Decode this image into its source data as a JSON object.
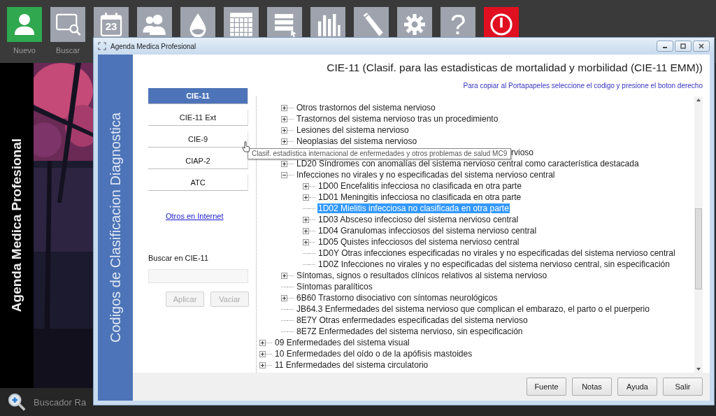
{
  "desktop": {
    "toolbar": [
      {
        "kind": "user",
        "color": "#2fa84f",
        "label": "Nuevo"
      },
      {
        "kind": "search",
        "color": "#9ea3ad",
        "label": "Buscar"
      },
      {
        "kind": "calendar",
        "color": "#9ea3ad",
        "text": "23"
      },
      {
        "kind": "people",
        "color": "#9ea3ad"
      },
      {
        "kind": "drop",
        "color": "#9ea3ad"
      },
      {
        "kind": "grid",
        "color": "#9ea3ad"
      },
      {
        "kind": "list",
        "color": "#9ea3ad"
      },
      {
        "kind": "chart",
        "color": "#9ea3ad"
      },
      {
        "kind": "pen",
        "color": "#9ea3ad"
      },
      {
        "kind": "gear",
        "color": "#9ea3ad"
      },
      {
        "kind": "help",
        "color": "#9ea3ad",
        "text": "?"
      },
      {
        "kind": "power",
        "color": "#e01020"
      }
    ],
    "side_title": "Agenda Medica Profesional",
    "quick_search": "Buscador Ra"
  },
  "window": {
    "title": "Agenda Medica Profesional",
    "side_title": "Codigos de Clasificacion Diagnostica",
    "heading": "CIE-11 (Clasif. para las estadisticas de mortalidad y morbilidad (CIE-11 EMM))",
    "hint": "Para copiar al Portapapeles seleccione el codigo y presione el boton derecho",
    "classifications": [
      {
        "label": "CIE-11",
        "selected": true
      },
      {
        "label": "CIE-11 Ext",
        "selected": false
      },
      {
        "label": "CIE-9",
        "selected": false
      },
      {
        "label": "CIAP-2",
        "selected": false
      },
      {
        "label": "ATC",
        "selected": false
      }
    ],
    "link": "Otros en Internet",
    "search": {
      "label": "Buscar en CIE-11",
      "buttons": [
        {
          "label": "Aplicar",
          "disabled": true
        },
        {
          "label": "Vaciar",
          "disabled": true
        }
      ]
    },
    "tooltip": "Clasif. estadística internacional de enfermedades y otros problemas de salud MC9",
    "tree": {
      "continued_branch": [
        {
          "text": "Otros trastornos del sistema nervioso",
          "expanded": false,
          "selected": false
        },
        {
          "text": "Trastornos del sistema nervioso tras un procedimiento",
          "expanded": false,
          "selected": false
        },
        {
          "text": "Lesiones del sistema nervioso",
          "expanded": false,
          "selected": false
        },
        {
          "text": "Neoplasias del sistema nervioso",
          "expanded": false,
          "selected": false
        },
        {
          "text": "rvioso",
          "partly_covered": true,
          "selected": false
        },
        {
          "text": "LD20 Síndromes con anomalías del sistema nervioso central como característica destacada",
          "expanded": false,
          "selected": false
        },
        {
          "text": "Infecciones no virales y no especificadas del sistema nervioso central",
          "expanded": true,
          "selected": false,
          "children": [
            {
              "text": "1D00 Encefalitis infecciosa no clasificada en otra parte",
              "expanded": false,
              "selected": false
            },
            {
              "text": "1D01 Meningitis infecciosa no clasificada en otra parte",
              "expanded": false,
              "selected": false
            },
            {
              "text": "1D02 Mielitis infecciosa no clasificada en otra parte",
              "selected": true
            },
            {
              "text": "1D03 Absceso infeccioso del sistema nervioso central",
              "expanded": false,
              "selected": false
            },
            {
              "text": "1D04 Granulomas infecciosos del sistema nervioso central",
              "expanded": false,
              "selected": false
            },
            {
              "text": "1D05 Quistes infecciosos del sistema nervioso central",
              "expanded": false,
              "selected": false
            },
            {
              "text": "1D0Y Otras infecciones especificadas no virales y no especificadas del sistema nervioso central",
              "selected": false
            },
            {
              "text": "1D0Z Infecciones no virales y no especificadas del sistema nervioso central, sin especificación",
              "selected": false
            }
          ]
        },
        {
          "text": "Síntomas, signos o resultados clínicos relativos al sistema nervioso",
          "expanded": false,
          "selected": false
        },
        {
          "text": "Síntomas paralíticos",
          "selected": false
        },
        {
          "text": "6B60 Trastorno disociativo con síntomas neurológicos",
          "expanded": false,
          "selected": false
        },
        {
          "text": "JB64.3 Enfermedades del sistema nervioso que complican el embarazo, el parto o el puerperio",
          "selected": false
        },
        {
          "text": "8E7Y Otras enfermedades especificadas del sistema nervioso",
          "selected": false
        },
        {
          "text": "8E7Z Enfermedades del sistema nervioso, sin especificación",
          "selected": false
        }
      ],
      "items": [
        {
          "text": "09 Enfermedades del sistema visual",
          "expanded": false,
          "selected": false
        },
        {
          "text": "10 Enfermedades del oído o de la apófisis mastoides",
          "expanded": false,
          "selected": false
        },
        {
          "text": "11 Enfermedades del sistema circulatorio",
          "expanded": false,
          "selected": false
        }
      ]
    },
    "footer_buttons": [
      "Fuente",
      "Notas",
      "Ayuda",
      "Salir"
    ]
  }
}
